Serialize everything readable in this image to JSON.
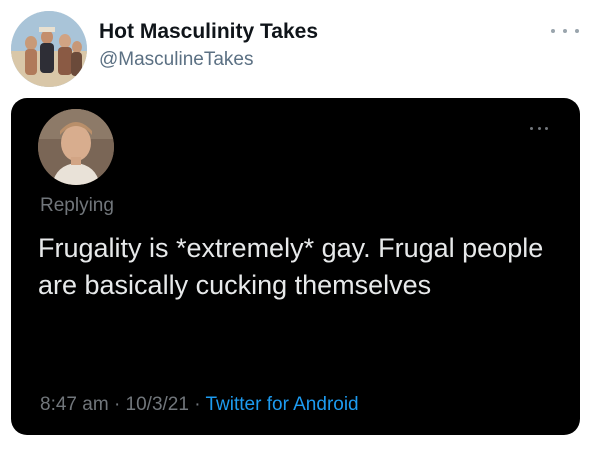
{
  "account": {
    "name": "Hot Masculinity Takes",
    "handle": "@MasculineTakes"
  },
  "embedded_tweet": {
    "replying_label": "Replying",
    "text": "Frugality is *extremely* gay. Frugal people are basically cucking themselves",
    "time": "8:47 am",
    "date": "10/3/21",
    "separator": "·",
    "source": "Twitter for Android"
  },
  "icons": {
    "more_options": "more-horizontal-icon"
  },
  "colors": {
    "card_background": "#000000",
    "link_blue": "#1d9bf0",
    "muted_gray": "#71767b",
    "handle_gray": "#5b7083"
  }
}
